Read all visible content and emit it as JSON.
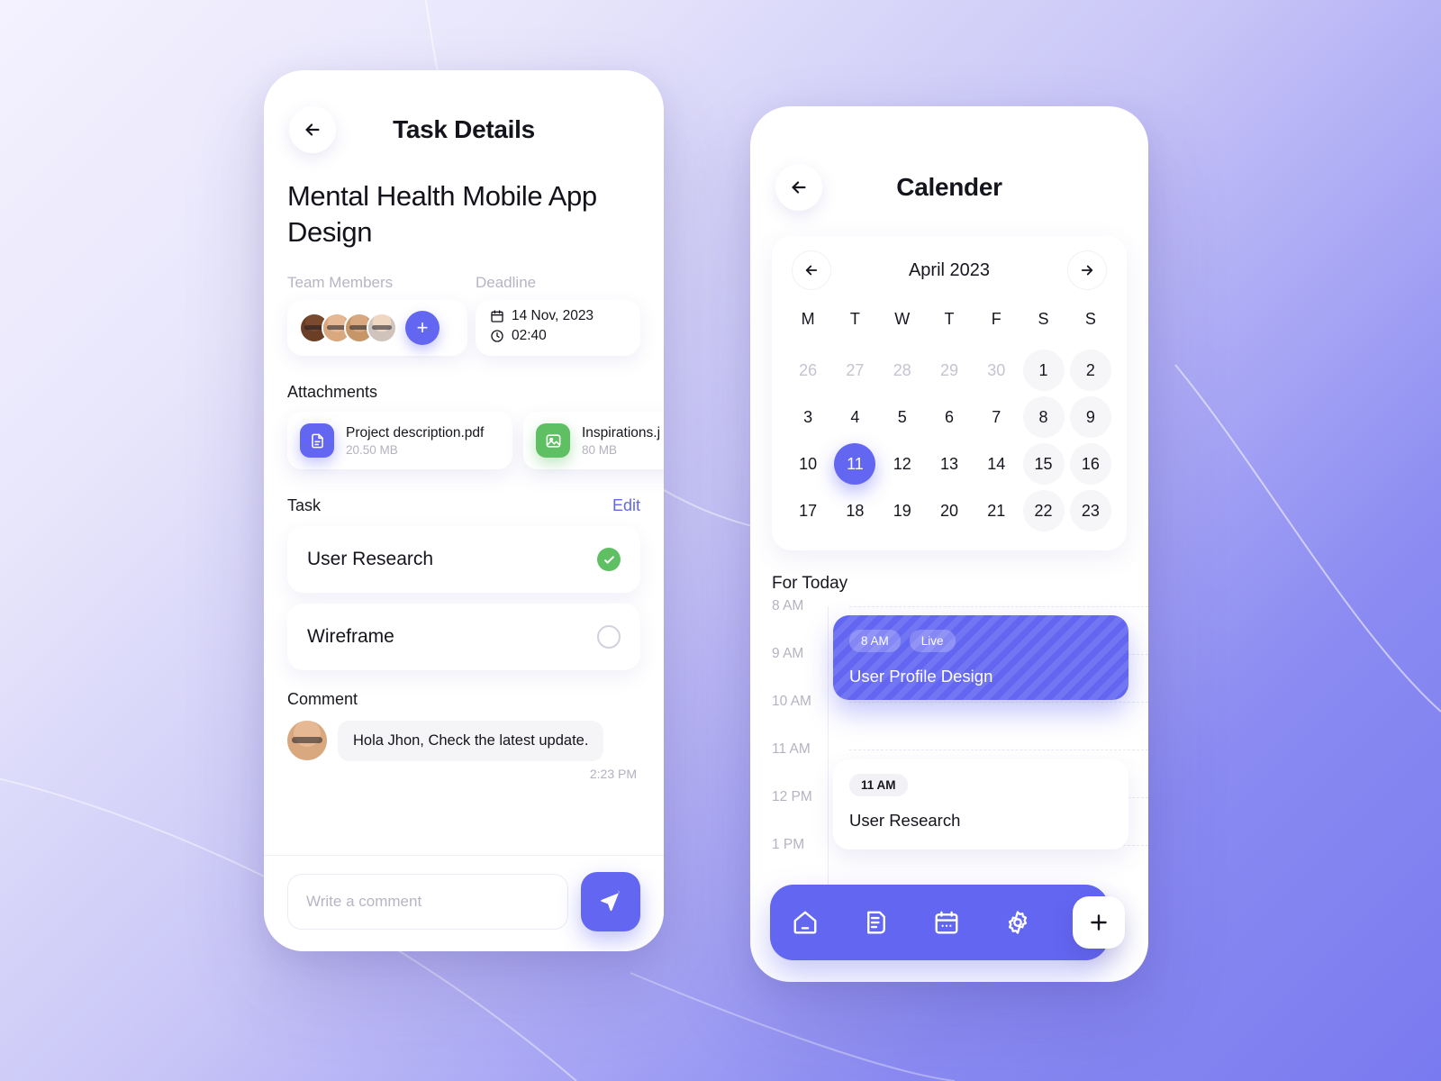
{
  "theme": {
    "accent": "#6366f1",
    "success": "#5fbf63",
    "bg_gradient_from": "#f4f2fe",
    "bg_gradient_to": "#7a7af0",
    "text_primary": "#14141c",
    "text_muted": "#b7b5c4"
  },
  "task_details": {
    "header": {
      "back_icon": "arrow-left-icon",
      "title": "Task Details"
    },
    "project_title": "Mental Health Mobile App Design",
    "labels": {
      "team_members": "Team Members",
      "deadline": "Deadline"
    },
    "team": {
      "avatar_count": 4,
      "add_label": "+"
    },
    "deadline": {
      "date_icon": "calendar-icon",
      "date": "14 Nov, 2023",
      "time_icon": "clock-icon",
      "time": "02:40"
    },
    "attachments": {
      "heading": "Attachments",
      "items": [
        {
          "icon": "document-icon",
          "name": "Project description.pdf",
          "size": "20.50 MB",
          "color": "#6366f1"
        },
        {
          "icon": "image-icon",
          "name": "Inspirations.j",
          "size": "80 MB",
          "color": "#5fbf63"
        }
      ]
    },
    "task_section": {
      "heading": "Task",
      "edit_label": "Edit",
      "items": [
        {
          "name": "User Research",
          "done": true,
          "state_icon": "check-circle-icon"
        },
        {
          "name": "Wireframe",
          "done": false,
          "state_icon": "circle-outline-icon"
        }
      ]
    },
    "comment_section": {
      "heading": "Comment",
      "comments": [
        {
          "avatar": "user-avatar",
          "text": "Hola Jhon, Check the latest update.",
          "time": "2:23 PM"
        }
      ],
      "composer": {
        "placeholder": "Write a comment",
        "value": "",
        "send_icon": "send-icon"
      }
    }
  },
  "calendar": {
    "header": {
      "back_icon": "arrow-left-icon",
      "title": "Calender"
    },
    "month_nav": {
      "prev_icon": "arrow-left-icon",
      "month_label": "April 2023",
      "next_icon": "arrow-right-icon"
    },
    "day_of_week": [
      "M",
      "T",
      "W",
      "T",
      "F",
      "S",
      "S"
    ],
    "weeks": [
      [
        {
          "d": "26",
          "muted": true,
          "weekend": false
        },
        {
          "d": "27",
          "muted": true,
          "weekend": false
        },
        {
          "d": "28",
          "muted": true,
          "weekend": false
        },
        {
          "d": "29",
          "muted": true,
          "weekend": false
        },
        {
          "d": "30",
          "muted": true,
          "weekend": false
        },
        {
          "d": "1",
          "muted": false,
          "weekend": true
        },
        {
          "d": "2",
          "muted": false,
          "weekend": true
        }
      ],
      [
        {
          "d": "3",
          "muted": false,
          "weekend": false
        },
        {
          "d": "4",
          "muted": false,
          "weekend": false
        },
        {
          "d": "5",
          "muted": false,
          "weekend": false
        },
        {
          "d": "6",
          "muted": false,
          "weekend": false
        },
        {
          "d": "7",
          "muted": false,
          "weekend": false
        },
        {
          "d": "8",
          "muted": false,
          "weekend": true
        },
        {
          "d": "9",
          "muted": false,
          "weekend": true
        }
      ],
      [
        {
          "d": "10",
          "muted": false,
          "weekend": false
        },
        {
          "d": "11",
          "muted": false,
          "weekend": false,
          "selected": true
        },
        {
          "d": "12",
          "muted": false,
          "weekend": false
        },
        {
          "d": "13",
          "muted": false,
          "weekend": false
        },
        {
          "d": "14",
          "muted": false,
          "weekend": false
        },
        {
          "d": "15",
          "muted": false,
          "weekend": true
        },
        {
          "d": "16",
          "muted": false,
          "weekend": true
        }
      ],
      [
        {
          "d": "17",
          "muted": false,
          "weekend": false
        },
        {
          "d": "18",
          "muted": false,
          "weekend": false
        },
        {
          "d": "19",
          "muted": false,
          "weekend": false
        },
        {
          "d": "20",
          "muted": false,
          "weekend": false
        },
        {
          "d": "21",
          "muted": false,
          "weekend": false
        },
        {
          "d": "22",
          "muted": false,
          "weekend": true
        },
        {
          "d": "23",
          "muted": false,
          "weekend": true
        }
      ]
    ],
    "agenda": {
      "heading": "For Today",
      "hours": [
        "8 AM",
        "9 AM",
        "10 AM",
        "11 AM",
        "12 PM",
        "1 PM"
      ],
      "events": [
        {
          "time_pill": "8 AM",
          "status_pill": "Live",
          "title": "User Profile Design",
          "style": "live"
        },
        {
          "time_pill": "11 AM",
          "status_pill": "",
          "title": "User Research",
          "style": "plain"
        }
      ]
    },
    "tabbar": {
      "items": [
        {
          "icon": "home-icon",
          "label": "Home"
        },
        {
          "icon": "document-list-icon",
          "label": "Tasks"
        },
        {
          "icon": "calendar-icon",
          "label": "Calendar"
        },
        {
          "icon": "gear-icon",
          "label": "Settings"
        }
      ],
      "fab": {
        "icon": "plus-icon",
        "label": "+"
      }
    }
  }
}
